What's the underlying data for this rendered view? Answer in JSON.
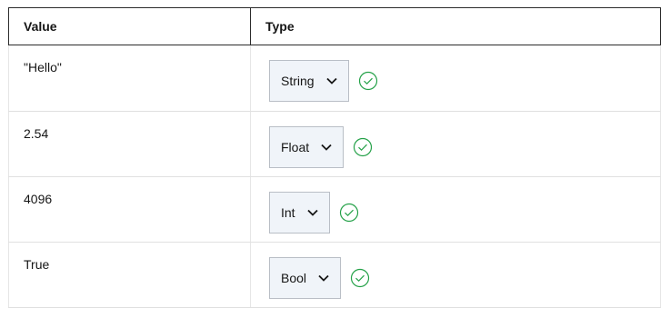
{
  "table": {
    "headers": {
      "value": "Value",
      "type": "Type"
    },
    "rows": [
      {
        "value": "\"Hello\"",
        "type": "String",
        "status_icon": "check-circle-icon"
      },
      {
        "value": "2.54",
        "type": "Float",
        "status_icon": "check-circle-icon"
      },
      {
        "value": "4096",
        "type": "Int",
        "status_icon": "check-circle-icon"
      },
      {
        "value": "True",
        "type": "Bool",
        "status_icon": "check-circle-icon"
      }
    ]
  },
  "colors": {
    "header_border": "#2b2b2b",
    "select_bg": "#f0f4f9",
    "select_border": "#b9bec6",
    "success": "#24a148"
  }
}
